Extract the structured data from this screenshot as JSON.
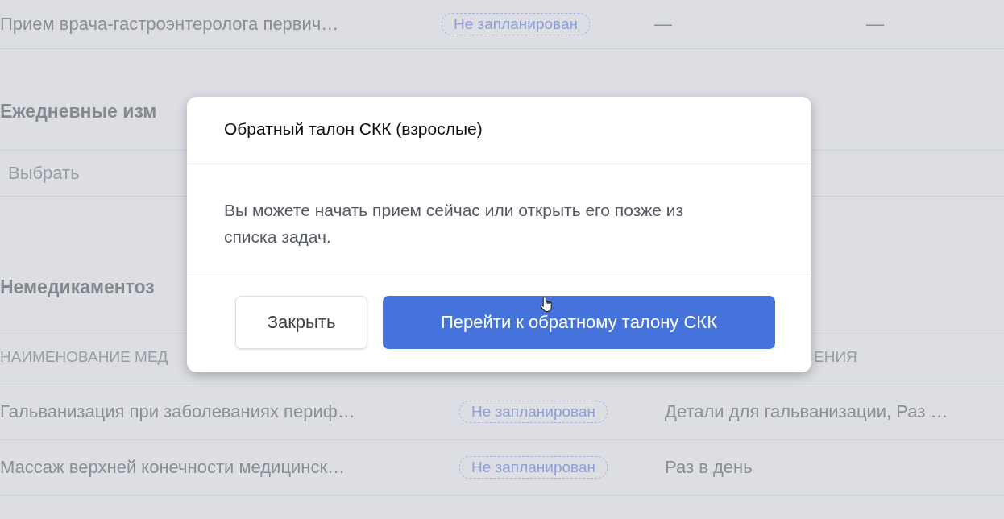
{
  "background": {
    "procedures": [
      {
        "name": "Прием врача-гастроэнтеролога первич…",
        "status": "Не запланирован",
        "column_3": "—",
        "column_4": "—"
      }
    ],
    "daily_section": {
      "title": "Ежедневные изм",
      "select": {
        "placeholder": "Выбрать"
      }
    },
    "nondrug_section": {
      "title": "Немедикаментоз",
      "columns": [
        "НАИМЕНОВАНИЕ МЕД",
        "ЕНИЯ"
      ],
      "rows": [
        {
          "name": "Гальванизация при заболеваниях периф…",
          "status": "Не запланирован",
          "details": "Детали для гальванизации, Раз …"
        },
        {
          "name": "Массаж верхней конечности медицинск…",
          "status": "Не запланирован",
          "details": "Раз в день"
        }
      ]
    }
  },
  "dialog": {
    "title": "Обратный талон СКК (взрослые)",
    "message": "Вы можете начать прием сейчас или открыть его позже из списка задач.",
    "buttons": [
      {
        "label": "Закрыть",
        "kind": "secondary"
      },
      {
        "label": "Перейти к обратному талону СКК",
        "kind": "primary"
      }
    ]
  }
}
